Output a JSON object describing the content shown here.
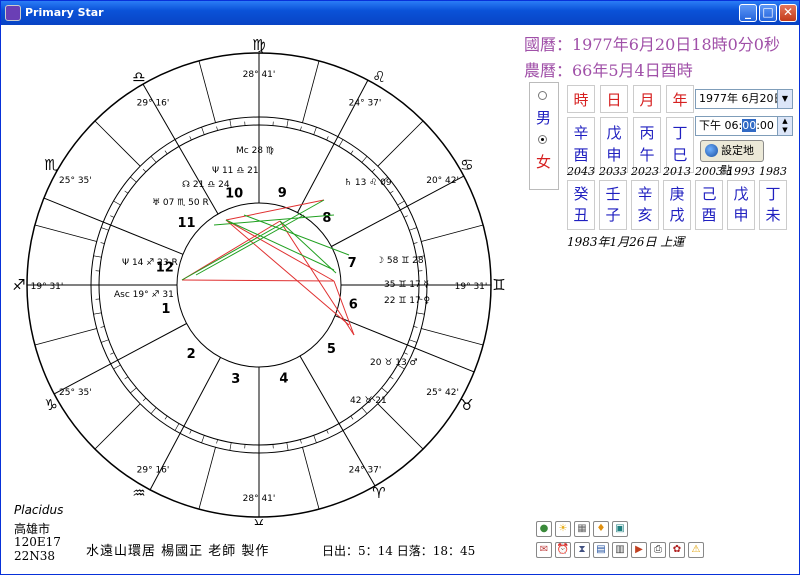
{
  "window": {
    "title": "Primary Star",
    "minimize": "_",
    "maximize": "□",
    "close": "✕"
  },
  "header": {
    "solar_date": "國曆：1977年6月20日18時0分0秒",
    "lunar_date": "農曆：66年5月4日酉時"
  },
  "gender": {
    "male": "男",
    "female": "女",
    "selected": "female"
  },
  "pillars": [
    {
      "header": "時",
      "stem": "辛",
      "branch": "酉"
    },
    {
      "header": "日",
      "stem": "戊",
      "branch": "申"
    },
    {
      "header": "月",
      "stem": "丙",
      "branch": "午"
    },
    {
      "header": "年",
      "stem": "丁",
      "branch": "巳"
    }
  ],
  "luck": [
    {
      "year": "2043",
      "stem": "癸",
      "branch": "丑"
    },
    {
      "year": "2033",
      "stem": "壬",
      "branch": "子"
    },
    {
      "year": "2023",
      "stem": "辛",
      "branch": "亥"
    },
    {
      "year": "2013",
      "stem": "庚",
      "branch": "戌"
    },
    {
      "year": "2003",
      "stem": "己",
      "branch": "酉"
    },
    {
      "year": "1993",
      "stem": "戊",
      "branch": "申"
    },
    {
      "year": "1983",
      "stem": "丁",
      "branch": "未"
    }
  ],
  "controls": {
    "date_value": "1977年 6月20日",
    "time_prefix": "下午 06:",
    "time_minutes": "00",
    "time_suffix": ":00",
    "set_location": "設定地點",
    "liuyun": "1983年1月26日 上運"
  },
  "footer": {
    "house_system": "Placidus",
    "city": "高雄市",
    "longitude": "120E17",
    "latitude": "22N38",
    "credit": "水遠山環居 楊國正 老師 製作",
    "sun_times": "日出：5：14 日落：18：45"
  },
  "zodiac_signs": [
    {
      "glyph": "♐",
      "deg": "19°",
      "min": "31'"
    },
    {
      "glyph": "♑",
      "deg": "25°",
      "min": "35'"
    },
    {
      "glyph": "♒",
      "deg": "29°",
      "min": "16'"
    },
    {
      "glyph": "♓",
      "deg": "28°",
      "min": "41'"
    },
    {
      "glyph": "♈",
      "deg": "24°",
      "min": "37'"
    },
    {
      "glyph": "♉",
      "deg": "25°",
      "min": "42'"
    },
    {
      "glyph": "♊",
      "deg": "19°",
      "min": "31'"
    },
    {
      "glyph": "♋",
      "deg": "20°",
      "min": "42'"
    },
    {
      "glyph": "♌",
      "deg": "24°",
      "min": "37'"
    },
    {
      "glyph": "♍",
      "deg": "28°",
      "min": "41'"
    },
    {
      "glyph": "♎",
      "deg": "29°",
      "min": "16'"
    },
    {
      "glyph": "♏",
      "deg": "25°",
      "min": "35'"
    }
  ],
  "houses": [
    "1",
    "2",
    "3",
    "4",
    "5",
    "6",
    "7",
    "8",
    "9",
    "10",
    "11",
    "12"
  ],
  "planet_labels": [
    "Ψ 14 ♐ 23 R",
    "Asc 19° ♐ 31",
    "♅ 07 ♏ 50 R",
    "♄ 13 ♌ 09",
    "☽ 58 ♊ 28",
    "35 ♊ 17 ☿",
    "22 ♊ 17 ♀",
    "20 ♉ 13 ♂",
    "42 ♉ 21",
    "Mc 28 ♍",
    "Ψ 11 ♎ 21",
    "☊ 21 ♎ 24"
  ],
  "toolbar_icons": [
    "green-globe",
    "sun",
    "calendar",
    "pin",
    "square",
    "print",
    "clock",
    "hourglass",
    "grid",
    "calculator",
    "car",
    "printer",
    "medal",
    "warning"
  ]
}
